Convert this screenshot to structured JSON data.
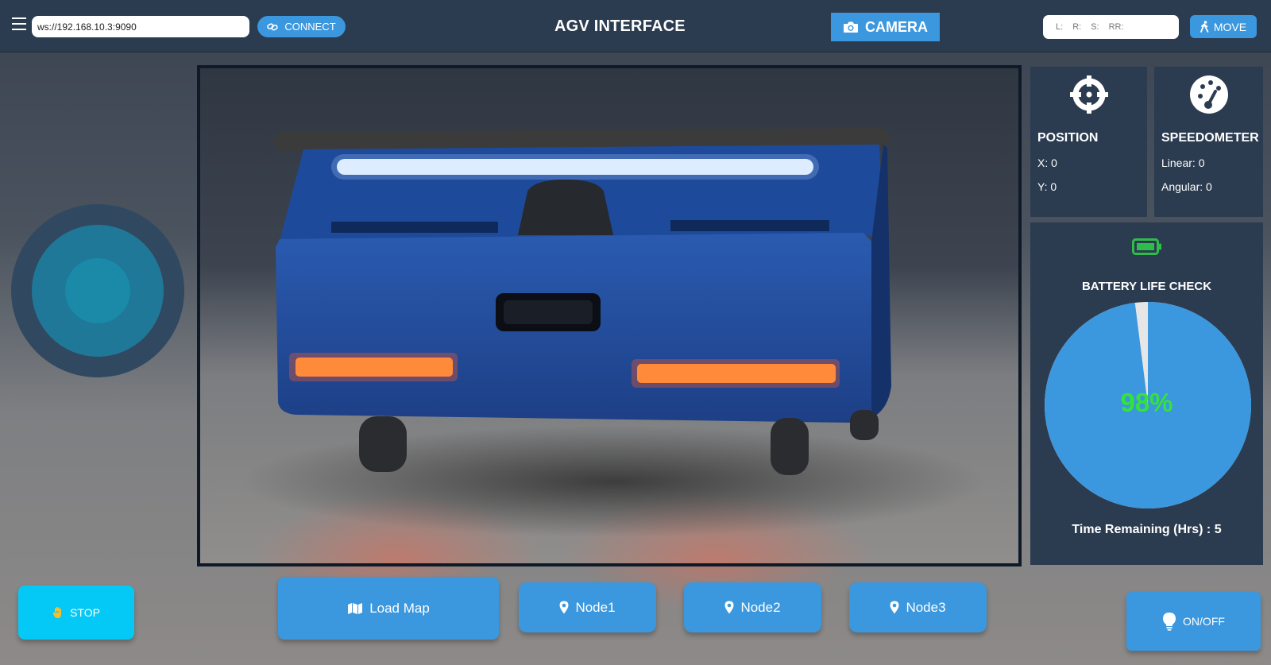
{
  "header": {
    "title": "AGV INTERFACE",
    "url_value": "ws://192.168.10.3:9090",
    "connect_label": "CONNECT",
    "camera_label": "CAMERA",
    "move_label": "MOVE",
    "status_fields": [
      "L:",
      "R:",
      "S:",
      "RR:"
    ]
  },
  "position": {
    "title": "POSITION",
    "x": "X: 0",
    "y": "Y: 0"
  },
  "speedometer": {
    "title": "SPEEDOMETER",
    "linear": "Linear: 0",
    "angular": "Angular: 0"
  },
  "battery": {
    "title": "BATTERY LIFE CHECK",
    "percent_label": "98%",
    "percent_value": 98,
    "time_remaining": "Time Remaining (Hrs) : 5",
    "colors": {
      "fill": "#3b97de",
      "remaining": "#e6e6e6",
      "label": "#35e23a",
      "icon": "#2fbd4a"
    }
  },
  "controls": {
    "stop_label": "STOP",
    "load_map_label": "Load Map",
    "nodes": [
      "Node1",
      "Node2",
      "Node3"
    ],
    "onoff_label": "ON/OFF"
  },
  "icons": {
    "menu": "menu-icon",
    "connect": "link-icon",
    "camera": "camera-icon",
    "move": "walking-person-icon",
    "position": "crosshair-icon",
    "speedometer": "gauge-icon",
    "battery": "battery-icon",
    "stop": "hand-icon",
    "load_map": "map-icon",
    "node": "map-pin-icon",
    "onoff": "lightbulb-icon"
  }
}
